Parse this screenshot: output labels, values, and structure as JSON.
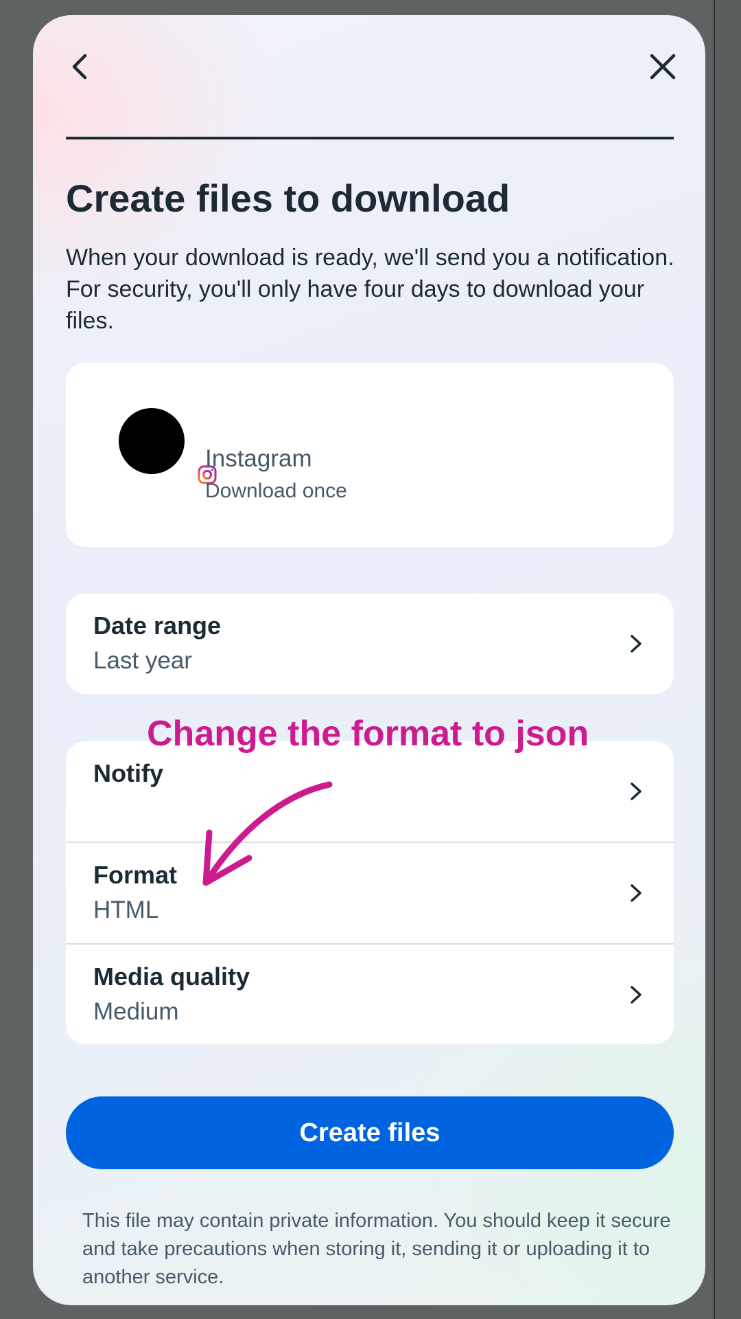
{
  "sheet": {
    "title": "Create files to download",
    "description": "When your download is ready, we'll send you a notification. For security, you'll only have four days to download your files.",
    "back_icon": "chevron-left-icon",
    "close_icon": "close-icon"
  },
  "profile": {
    "app_name": "Instagram",
    "frequency": "Download once",
    "badge_icon": "instagram-icon"
  },
  "date_range": {
    "label": "Date range",
    "value": "Last year"
  },
  "settings": [
    {
      "label": "Notify",
      "value": ""
    },
    {
      "label": "Format",
      "value": "HTML"
    },
    {
      "label": "Media quality",
      "value": "Medium"
    }
  ],
  "cta": {
    "label": "Create files",
    "color": "#0064e0"
  },
  "footnote": "This file may contain private information. You should keep it secure and take precautions when storing it, sending it or uploading it to another service.",
  "annotation": {
    "text": "Change the format to json",
    "color": "#cc1b8f"
  }
}
